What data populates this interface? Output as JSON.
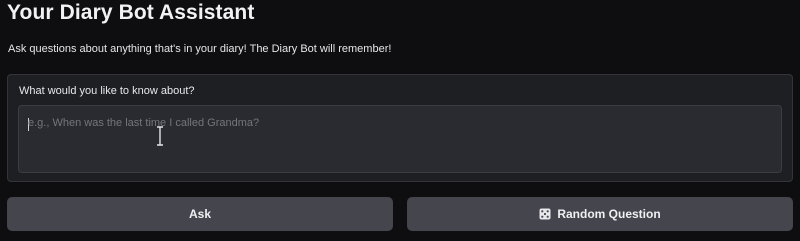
{
  "header": {
    "title": "Your Diary Bot Assistant",
    "subtitle": "Ask questions about anything that's in your diary! The Diary Bot will remember!"
  },
  "query": {
    "label": "What would you like to know about?",
    "value": "",
    "placeholder": "e.g., When was the last time I called Grandma?"
  },
  "actions": {
    "ask_label": "Ask",
    "random_label": "Random Question",
    "random_icon": "dice-icon"
  },
  "colors": {
    "background": "#0e0e11",
    "panel": "#1e1f23",
    "input": "#2a2b30",
    "button": "#44454d"
  }
}
